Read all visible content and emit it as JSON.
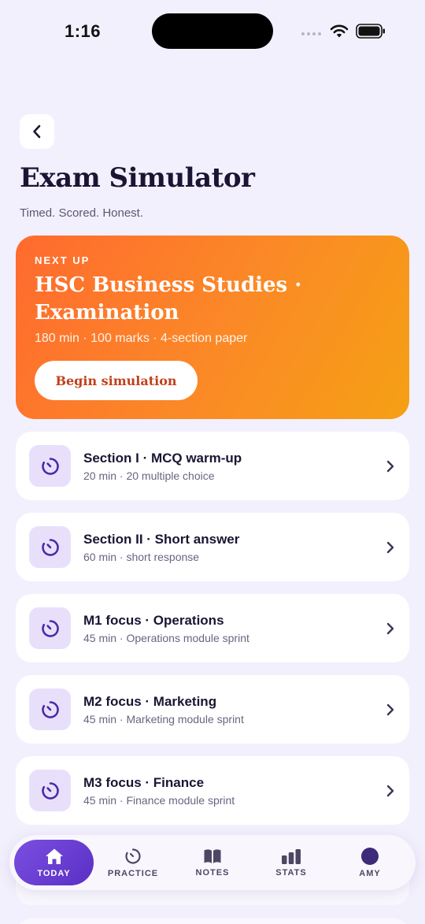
{
  "status_bar": {
    "time": "1:16"
  },
  "header": {
    "title": "Exam Simulator",
    "subtitle": "Timed. Scored. Honest."
  },
  "hero": {
    "eyebrow": "NEXT UP",
    "title": "HSC Business Studies · Examination",
    "meta": "180 min · 100 marks · 4-section paper",
    "button_label": "Begin simulation"
  },
  "sections": [
    {
      "title": "Section I · MCQ warm-up",
      "meta": "20 min · 20 multiple choice"
    },
    {
      "title": "Section II · Short answer",
      "meta": "60 min · short response"
    },
    {
      "title": "M1 focus · Operations",
      "meta": "45 min · Operations module sprint"
    },
    {
      "title": "M2 focus · Marketing",
      "meta": "45 min · Marketing module sprint"
    },
    {
      "title": "M3 focus · Finance",
      "meta": "45 min · Finance module sprint"
    }
  ],
  "tab_bar": {
    "tabs": [
      {
        "label": "TODAY",
        "icon": "home-icon",
        "active": true
      },
      {
        "label": "PRACTICE",
        "icon": "timer-icon",
        "active": false
      },
      {
        "label": "NOTES",
        "icon": "book-icon",
        "active": false
      },
      {
        "label": "STATS",
        "icon": "bar-chart-icon",
        "active": false
      },
      {
        "label": "AMY",
        "icon": "avatar",
        "active": false
      }
    ]
  },
  "colors": {
    "background": "#f3f0fd",
    "hero_gradient_start": "#ff6a2f",
    "hero_gradient_end": "#f5a014",
    "accent_purple": "#5a2fc4",
    "icon_tile": "#e8e0fb"
  }
}
